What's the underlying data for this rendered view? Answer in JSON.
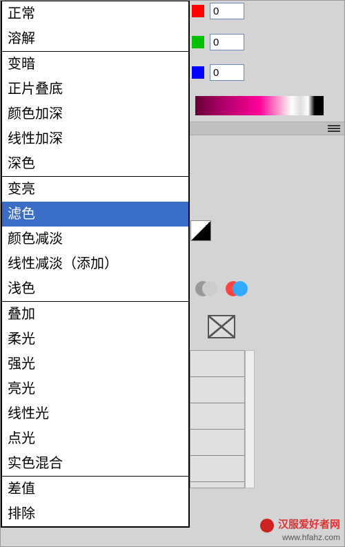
{
  "color_inputs": {
    "r": "0",
    "g": "0",
    "b": "0"
  },
  "blend_modes": {
    "selected": "滤色",
    "groups": [
      {
        "items": [
          "正常",
          "溶解"
        ]
      },
      {
        "items": [
          "变暗",
          "正片叠底",
          "颜色加深",
          "线性加深",
          "深色"
        ]
      },
      {
        "items": [
          "变亮",
          "滤色",
          "颜色减淡",
          "线性减淡（添加）",
          "浅色"
        ]
      },
      {
        "items": [
          "叠加",
          "柔光",
          "强光",
          "亮光",
          "线性光",
          "点光",
          "实色混合"
        ]
      },
      {
        "items": [
          "差值",
          "排除"
        ]
      }
    ]
  },
  "watermark": {
    "title": "汉服爱好者网",
    "url": "www.hfahz.com"
  }
}
